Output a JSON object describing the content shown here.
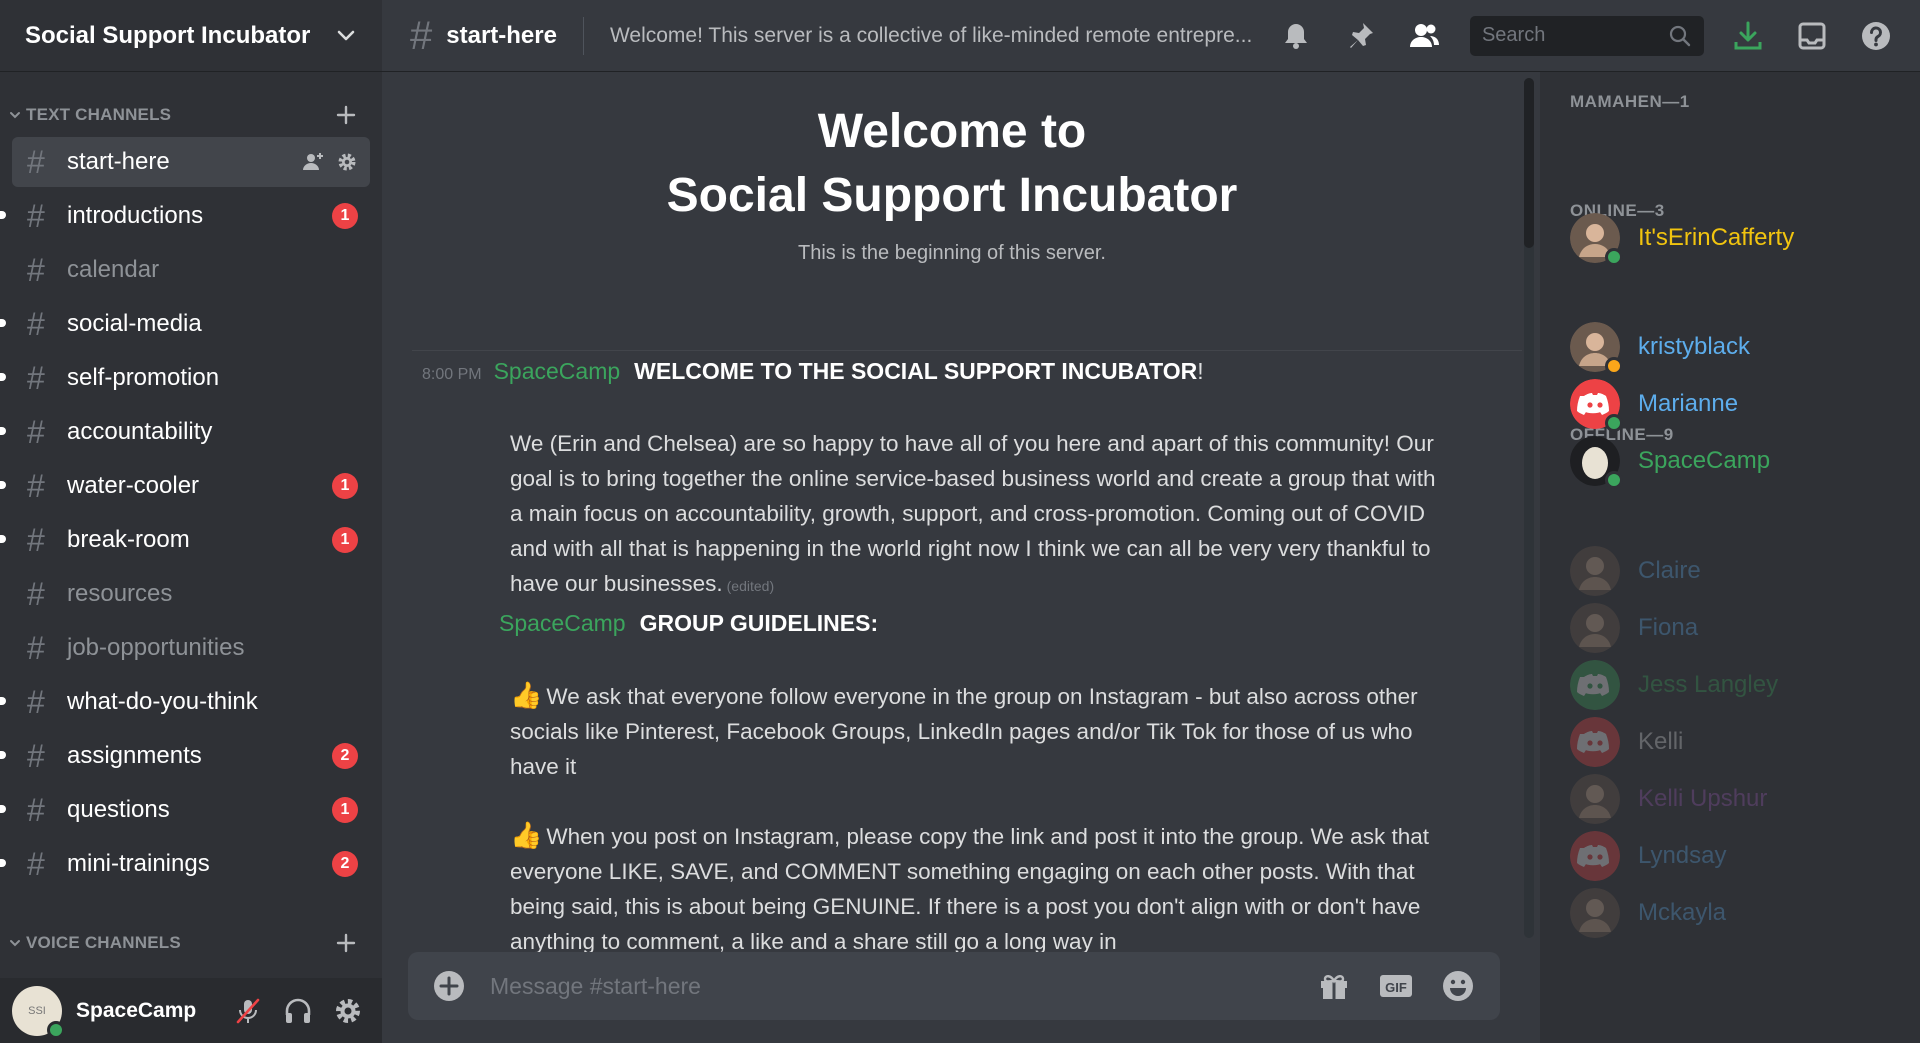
{
  "server": {
    "name": "Social Support Incubator"
  },
  "sidebar": {
    "text_category": "TEXT CHANNELS",
    "voice_category": "VOICE CHANNELS",
    "channels": [
      {
        "name": "start-here",
        "active": true,
        "unread": false,
        "badge": ""
      },
      {
        "name": "introductions",
        "active": false,
        "unread": true,
        "badge": "1"
      },
      {
        "name": "calendar",
        "active": false,
        "unread": false,
        "badge": ""
      },
      {
        "name": "social-media",
        "active": false,
        "unread": true,
        "badge": ""
      },
      {
        "name": "self-promotion",
        "active": false,
        "unread": true,
        "badge": ""
      },
      {
        "name": "accountability",
        "active": false,
        "unread": true,
        "badge": ""
      },
      {
        "name": "water-cooler",
        "active": false,
        "unread": true,
        "badge": "1"
      },
      {
        "name": "break-room",
        "active": false,
        "unread": true,
        "badge": "1"
      },
      {
        "name": "resources",
        "active": false,
        "unread": false,
        "badge": ""
      },
      {
        "name": "job-opportunities",
        "active": false,
        "unread": false,
        "badge": ""
      },
      {
        "name": "what-do-you-think",
        "active": false,
        "unread": true,
        "badge": ""
      },
      {
        "name": "assignments",
        "active": false,
        "unread": true,
        "badge": "2"
      },
      {
        "name": "questions",
        "active": false,
        "unread": true,
        "badge": "1"
      },
      {
        "name": "mini-trainings",
        "active": false,
        "unread": true,
        "badge": "2"
      }
    ]
  },
  "user_panel": {
    "username": "SpaceCamp",
    "avatar_text": "SSI"
  },
  "topbar": {
    "channel": "start-here",
    "topic": "Welcome! This server is a collective of like-minded remote entrepre...",
    "search_placeholder": "Search"
  },
  "chat": {
    "welcome_line1": "Welcome to",
    "welcome_line2": "Social Support Incubator",
    "welcome_sub": "This is the beginning of this server.",
    "messages": [
      {
        "time": "8:00 PM",
        "author": "SpaceCamp",
        "title": "WELCOME TO THE SOCIAL SUPPORT INCUBATOR",
        "title_suffix": "!",
        "body": "We (Erin and Chelsea) are so happy to have all of you here and apart of this community! Our goal is to bring together the online service-based business world and create a group that with a main focus on accountability, growth, support, and cross-promotion. Coming out of COVID and with all that is happening in the world right now I think we can all be very very thankful to have our businesses.",
        "edited": "(edited)"
      },
      {
        "author": "SpaceCamp",
        "title": "GROUP GUIDELINES:",
        "para1": "We ask that everyone follow everyone in the group on Instagram - but also across other socials like Pinterest, Facebook Groups, LinkedIn pages and/or Tik Tok for those of us who have it",
        "para2": "When you post on Instagram, please copy the link and post it into the group. We ask that everyone LIKE, SAVE, and COMMENT something engaging on each other posts. With that being said, this is about being GENUINE. If there is a post you don't align with or don't have anything to comment, a like and a share still go a long way in"
      }
    ],
    "composer_placeholder": "Message #start-here"
  },
  "members": {
    "groups": [
      {
        "title": "MAMAHEN—1"
      },
      {
        "title": "ONLINE—3"
      },
      {
        "title": "OFFLINE—9"
      }
    ],
    "list": [
      {
        "name": "It'sErinCafferty",
        "color": "#f1c40f",
        "status": "online",
        "avatar": "photo"
      },
      {
        "name": "kristyblack",
        "color": "#5dadec",
        "status": "idle",
        "avatar": "photo"
      },
      {
        "name": "Marianne",
        "color": "#5dadec",
        "status": "online",
        "avatar": "discord-red"
      },
      {
        "name": "SpaceCamp",
        "color": "#3ba55d",
        "status": "online",
        "avatar": "egg"
      },
      {
        "name": "Claire",
        "color": "#5dadec",
        "status": "offline",
        "avatar": "photo"
      },
      {
        "name": "Fiona",
        "color": "#5dadec",
        "status": "offline",
        "avatar": "photo"
      },
      {
        "name": "Jess Langley",
        "color": "#3ba55d",
        "status": "offline",
        "avatar": "discord-green"
      },
      {
        "name": "Kelli",
        "color": "#dcddde",
        "status": "offline",
        "avatar": "discord-red"
      },
      {
        "name": "Kelli Upshur",
        "color": "#9b59b6",
        "status": "offline",
        "avatar": "photo"
      },
      {
        "name": "Lyndsay",
        "color": "#5dadec",
        "status": "offline",
        "avatar": "discord-red"
      },
      {
        "name": "Mckayla",
        "color": "#5dadec",
        "status": "offline",
        "avatar": "photo"
      }
    ]
  }
}
